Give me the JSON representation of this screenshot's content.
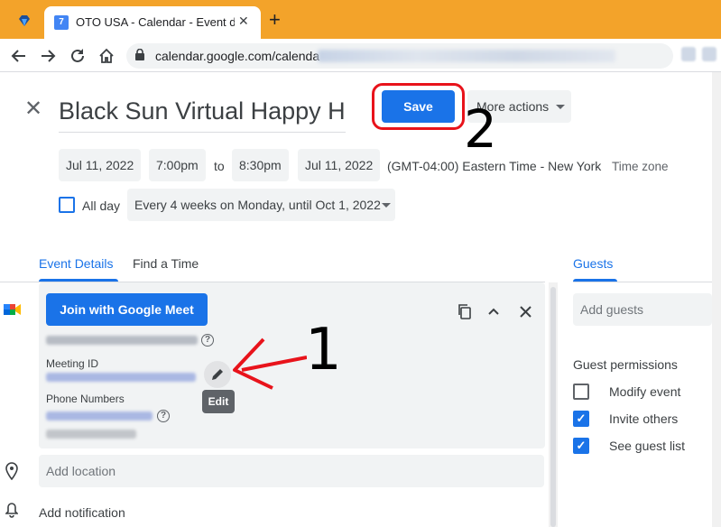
{
  "browser": {
    "tab_title": "OTO USA - Calendar - Event deta",
    "tab_favicon_text": "7",
    "tab_close": "✕",
    "new_tab": "+",
    "url": "calendar.google.com/calenda",
    "nav_icons": [
      "back-icon",
      "forward-icon",
      "reload-icon",
      "home-icon"
    ]
  },
  "event": {
    "close": "✕",
    "title": "Black Sun Virtual Happy H",
    "save_label": "Save",
    "more_actions_label": "More actions",
    "start_date": "Jul 11, 2022",
    "start_time": "7:00pm",
    "to_label": "to",
    "end_time": "8:30pm",
    "end_date": "Jul 11, 2022",
    "timezone_value": "(GMT-04:00) Eastern Time - New York",
    "timezone_link": "Time zone",
    "all_day_label": "All day",
    "recurrence": "Every 4 weeks on Monday, until Oct 1, 2022"
  },
  "tabs": {
    "event_details": "Event Details",
    "find_a_time": "Find a Time",
    "guests": "Guests"
  },
  "meet": {
    "join_label": "Join with Google Meet",
    "meeting_id_label": "Meeting ID",
    "phone_numbers_label": "Phone Numbers",
    "edit_tooltip": "Edit",
    "help_glyph": "?"
  },
  "location_placeholder": "Add location",
  "add_notification": "Add notification",
  "guests": {
    "add_placeholder": "Add guests",
    "permissions_title": "Guest permissions",
    "permissions": [
      {
        "label": "Modify event",
        "checked": false
      },
      {
        "label": "Invite others",
        "checked": true
      },
      {
        "label": "See guest list",
        "checked": true
      }
    ]
  },
  "annotations": {
    "step1": "1",
    "step2": "2"
  },
  "colors": {
    "primary": "#1a73e8",
    "annotation_red": "#e8131b",
    "tabbar": "#f3a32a"
  }
}
